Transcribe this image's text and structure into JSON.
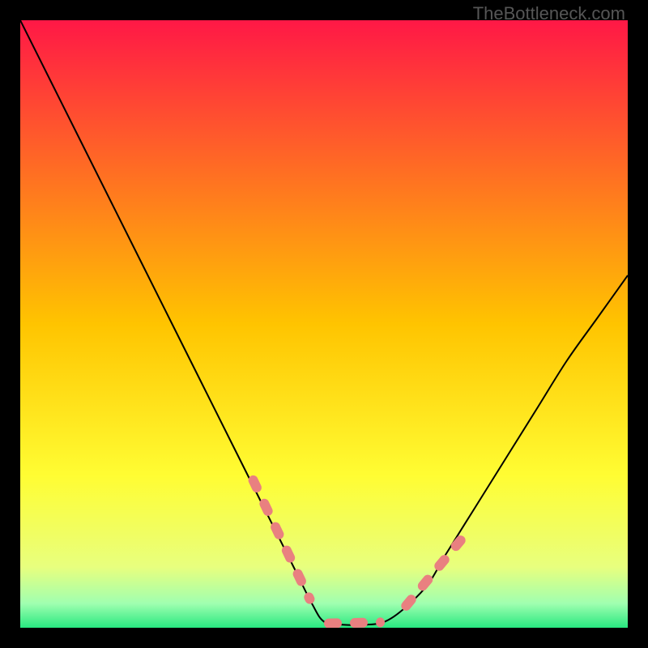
{
  "watermark": "TheBottleneck.com",
  "chart_data": {
    "type": "line",
    "title": "",
    "xlabel": "",
    "ylabel": "",
    "xlim": [
      0,
      100
    ],
    "ylim": [
      0,
      100
    ],
    "grid": false,
    "legend": false,
    "background_gradient": {
      "stops": [
        {
          "offset": 0.0,
          "color": "#ff1846"
        },
        {
          "offset": 0.5,
          "color": "#ffc400"
        },
        {
          "offset": 0.75,
          "color": "#fffd33"
        },
        {
          "offset": 0.9,
          "color": "#e8ff7e"
        },
        {
          "offset": 0.96,
          "color": "#a0ffb0"
        },
        {
          "offset": 1.0,
          "color": "#28e880"
        }
      ]
    },
    "series": [
      {
        "name": "bottleneck-curve",
        "color": "#000000",
        "x": [
          0,
          5,
          10,
          15,
          20,
          25,
          30,
          35,
          40,
          45,
          48,
          50,
          53,
          57,
          60,
          63,
          67,
          70,
          75,
          80,
          85,
          90,
          95,
          100
        ],
        "values": [
          100,
          90,
          80,
          70,
          60,
          50,
          40,
          30,
          20,
          10,
          4,
          1,
          0.5,
          0.5,
          1,
          3,
          7,
          12,
          20,
          28,
          36,
          44,
          51,
          58
        ]
      }
    ],
    "highlight_segments": {
      "name": "dashed-pink-markers",
      "color": "#e98080",
      "segments": [
        {
          "x": [
            38,
            48
          ],
          "values": [
            25,
            4
          ]
        },
        {
          "x": [
            50,
            60
          ],
          "values": [
            0.7,
            0.9
          ]
        },
        {
          "x": [
            63,
            73
          ],
          "values": [
            3,
            15
          ]
        }
      ]
    }
  }
}
